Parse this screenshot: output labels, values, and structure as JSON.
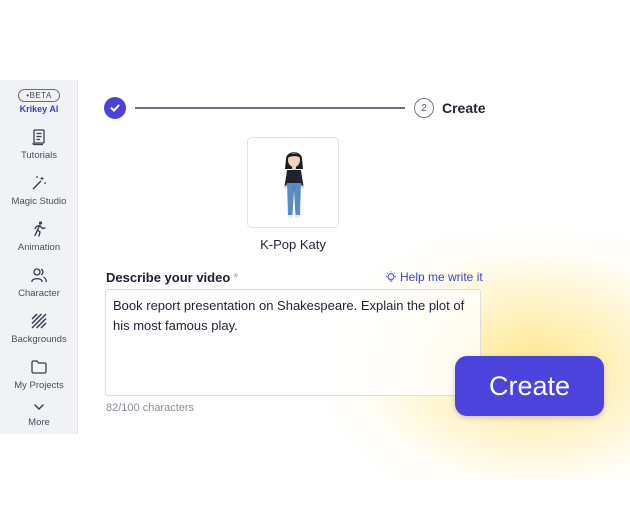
{
  "sidebar": {
    "badge": "•BETA",
    "brand": "Krikey AI",
    "items": [
      {
        "label": "Tutorials",
        "icon": "tutorials-icon"
      },
      {
        "label": "Magic Studio",
        "icon": "magic-wand-icon"
      },
      {
        "label": "Animation",
        "icon": "running-figure-icon"
      },
      {
        "label": "Character",
        "icon": "users-icon"
      },
      {
        "label": "Backgrounds",
        "icon": "stripes-icon"
      },
      {
        "label": "My Projects",
        "icon": "folder-icon"
      },
      {
        "label": "More",
        "icon": "chevron-down-icon"
      }
    ]
  },
  "stepper": {
    "step_number": "2",
    "step_label": "Create"
  },
  "character": {
    "name": "K-Pop Katy"
  },
  "prompt": {
    "title": "Describe your video",
    "required_mark": "*",
    "help_label": "Help me write it",
    "text": "Book report presentation on Shakespeare. Explain the plot of his most famous play.",
    "char_count": "82/100 characters"
  },
  "create_button": {
    "label": "Create"
  },
  "colors": {
    "accent": "#4b43dc",
    "brand_text": "#3b3fcf",
    "glow": "#ffe278"
  }
}
